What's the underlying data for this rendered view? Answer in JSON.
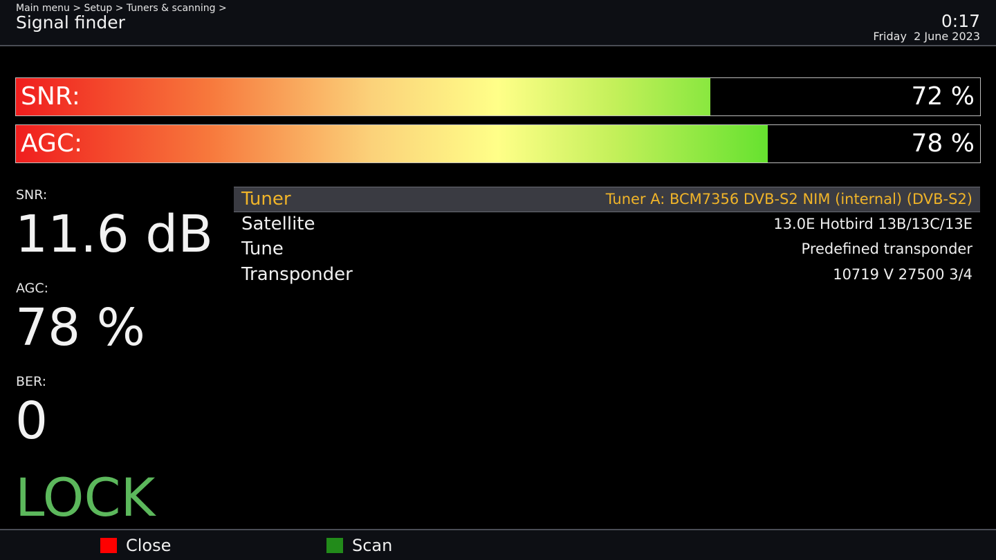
{
  "header": {
    "breadcrumb": "Main menu > Setup > Tuners & scanning >",
    "title": "Signal finder",
    "time": "0:17",
    "date": "Friday  2 June 2023"
  },
  "bars": [
    {
      "label": "SNR:",
      "value_text": "72 %",
      "percent": 72
    },
    {
      "label": "AGC:",
      "value_text": "78 %",
      "percent": 78
    }
  ],
  "stats": {
    "snr_label": "SNR:",
    "snr_value": "11.6 dB",
    "agc_label": "AGC:",
    "agc_value": "78 %",
    "ber_label": "BER:",
    "ber_value": "0",
    "lock_status": "LOCK"
  },
  "config": {
    "rows": [
      {
        "key": "Tuner",
        "value": "Tuner A: BCM7356 DVB-S2 NIM (internal) (DVB-S2)",
        "selected": true
      },
      {
        "key": "Satellite",
        "value": "13.0E Hotbird 13B/13C/13E",
        "selected": false
      },
      {
        "key": "Tune",
        "value": "Predefined transponder",
        "selected": false
      },
      {
        "key": "Transponder",
        "value": "10719 V 27500 3/4",
        "selected": false
      }
    ]
  },
  "footer": {
    "close_label": "Close",
    "scan_label": "Scan",
    "colors": {
      "red": "#ff0000",
      "green": "#228b1a"
    }
  },
  "colors": {
    "accent_selected": "#f0b429",
    "lock": "#5cb85c"
  }
}
